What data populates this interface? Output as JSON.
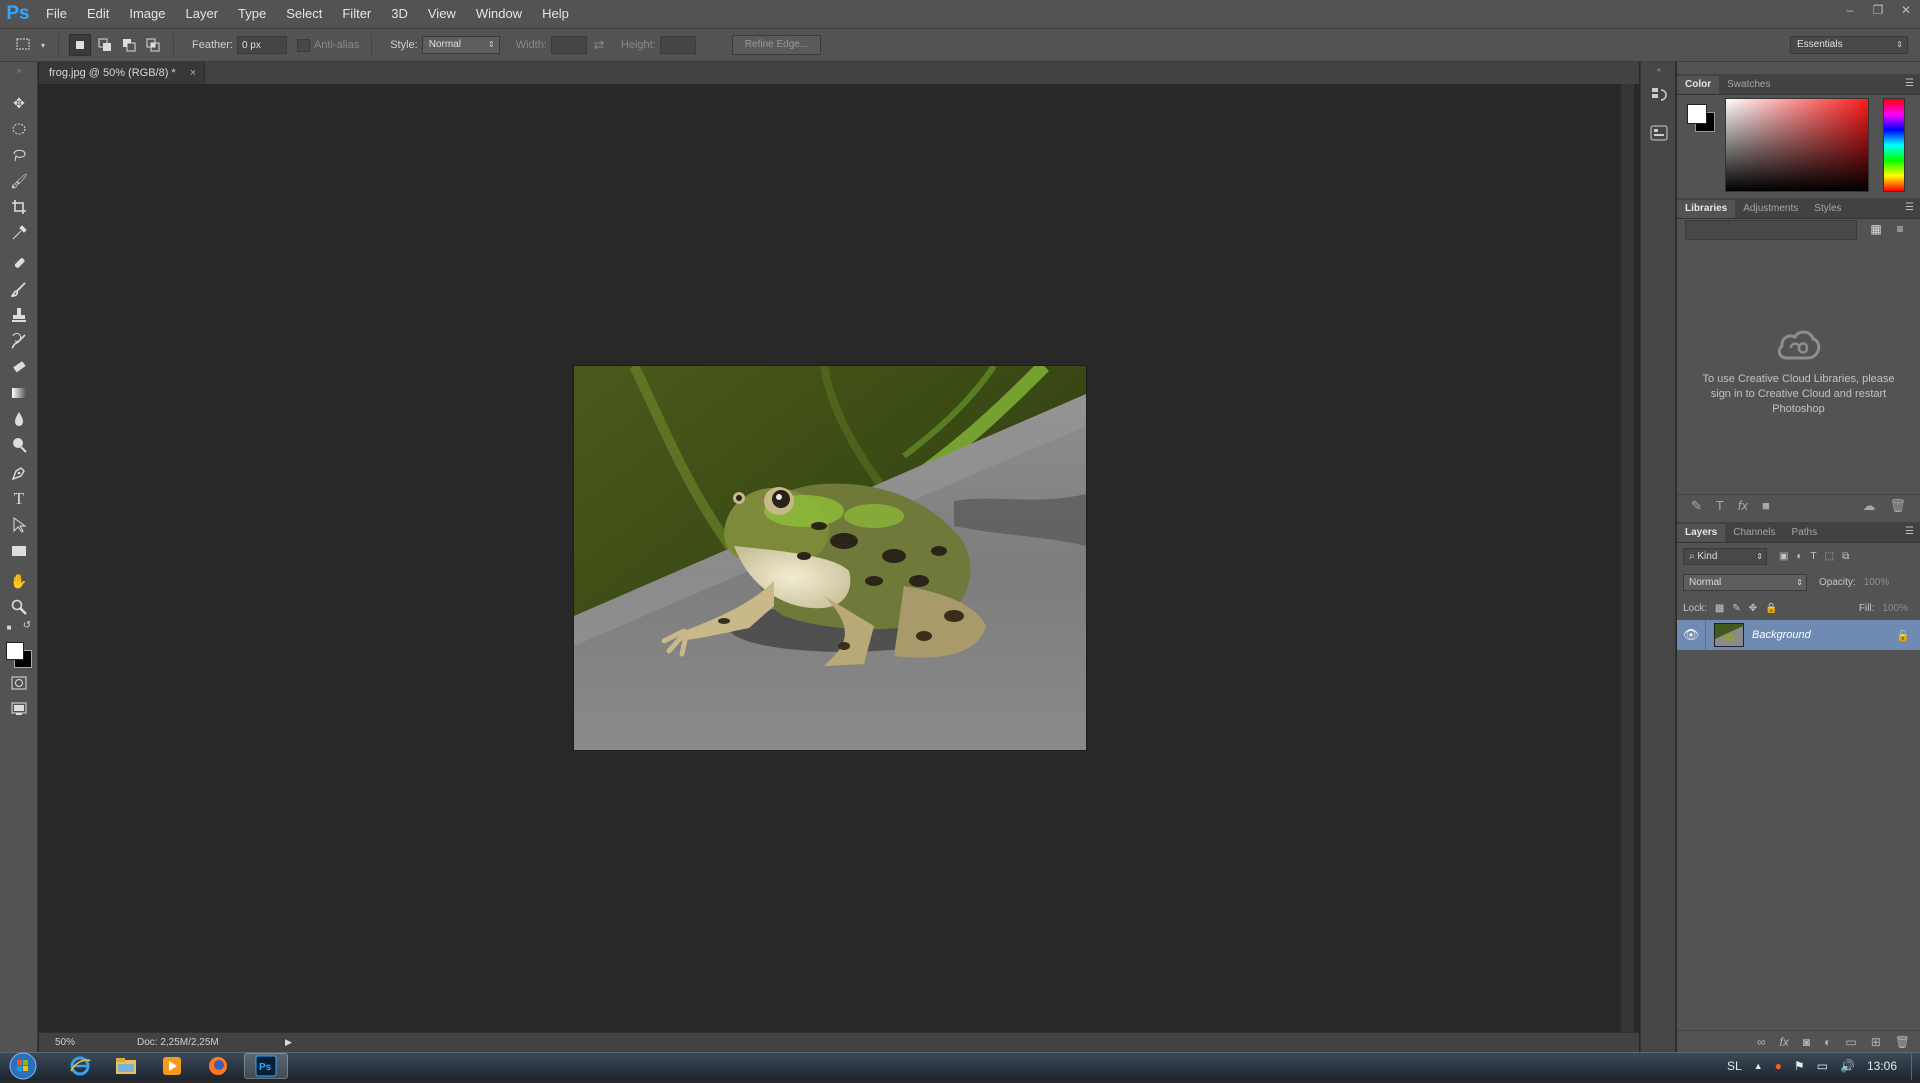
{
  "app": {
    "logo": "Ps"
  },
  "menu": [
    "File",
    "Edit",
    "Image",
    "Layer",
    "Type",
    "Select",
    "Filter",
    "3D",
    "View",
    "Window",
    "Help"
  ],
  "window_controls": {
    "minimize": "–",
    "restore": "❐",
    "close": "✕"
  },
  "options": {
    "feather_label": "Feather:",
    "feather_value": "0 px",
    "antialias_label": "Anti-alias",
    "style_label": "Style:",
    "style_value": "Normal",
    "width_label": "Width:",
    "height_label": "Height:",
    "refine_edge": "Refine Edge...",
    "workspace": "Essentials"
  },
  "document": {
    "tab_title": "frog.jpg @ 50% (RGB/8) *",
    "tab_close": "×",
    "zoom": "50%",
    "doc_size": "Doc: 2,25M/2,25M"
  },
  "color_panel": {
    "tabs": [
      "Color",
      "Swatches"
    ],
    "fg": "#ffffff",
    "bg": "#000000"
  },
  "libraries_panel": {
    "tabs": [
      "Libraries",
      "Adjustments",
      "Styles"
    ],
    "message": "To use Creative Cloud Libraries, please sign in to Creative Cloud and restart Photoshop"
  },
  "layers_panel": {
    "tabs": [
      "Layers",
      "Channels",
      "Paths"
    ],
    "filter_kind": "Kind",
    "blend_mode": "Normal",
    "opacity_label": "Opacity:",
    "opacity_value": "100%",
    "lock_label": "Lock:",
    "fill_label": "Fill:",
    "fill_value": "100%",
    "layers": [
      {
        "name": "Background",
        "visible": true,
        "locked": true
      }
    ]
  },
  "taskbar": {
    "language": "SL",
    "clock": "13:06",
    "apps": [
      "internet-explorer",
      "file-explorer",
      "media-player",
      "firefox",
      "photoshop"
    ]
  },
  "colors": {
    "accent": "#31a8ff",
    "selected_layer": "#6f8ab3",
    "panel": "#535353",
    "canvas_bg": "#282828"
  }
}
